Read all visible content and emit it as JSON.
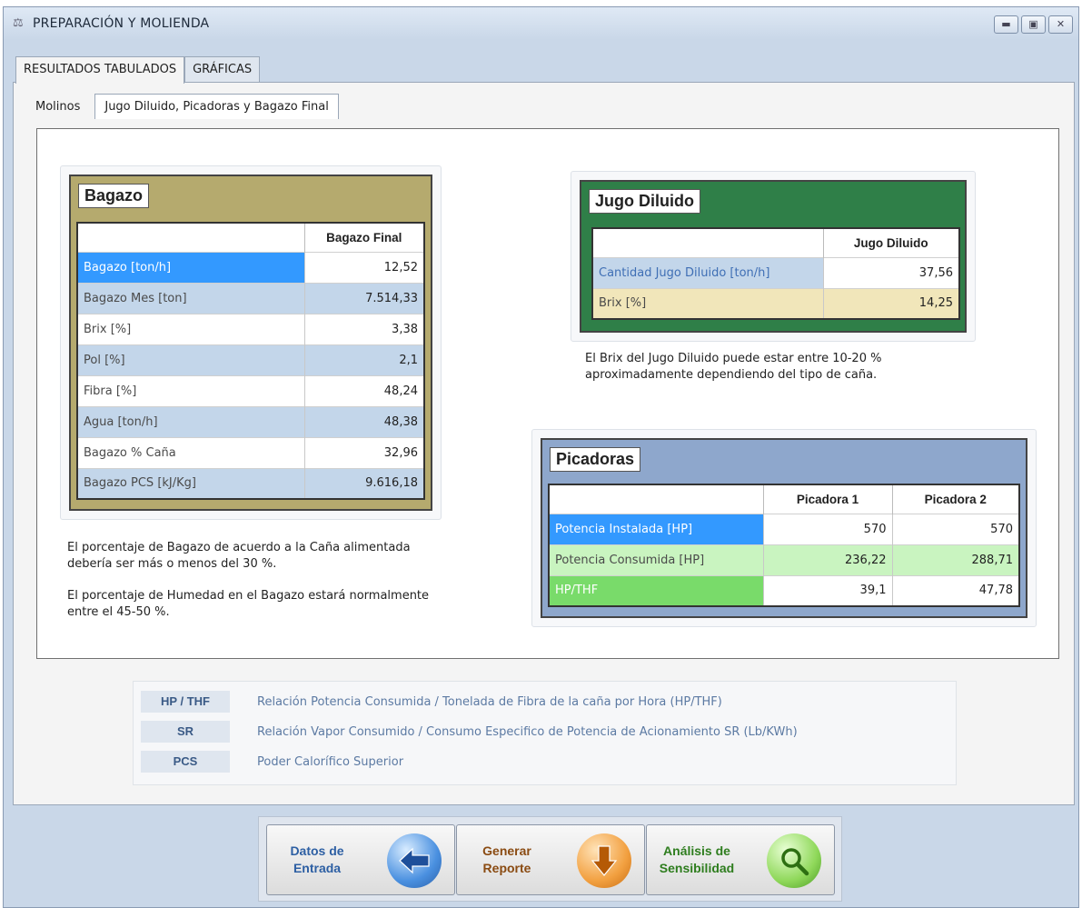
{
  "window": {
    "title": "PREPARACIÓN Y MOLIENDA",
    "controls": [
      "minimize",
      "maximize",
      "close"
    ]
  },
  "tabs": [
    {
      "label": "RESULTADOS TABULADOS",
      "active": true
    },
    {
      "label": "GRÁFICAS",
      "active": false
    }
  ],
  "subtabs": [
    {
      "label": "Molinos",
      "active": false
    },
    {
      "label": "Jugo Diluido, Picadoras y Bagazo Final",
      "active": true
    }
  ],
  "bagazo": {
    "title": "Bagazo",
    "column": "Bagazo Final",
    "rows": [
      {
        "label": "Bagazo [ton/h]",
        "value": "12,52"
      },
      {
        "label": "Bagazo Mes [ton]",
        "value": "7.514,33"
      },
      {
        "label": "Brix [%]",
        "value": "3,38"
      },
      {
        "label": "Pol [%]",
        "value": "2,1"
      },
      {
        "label": "Fibra [%]",
        "value": "48,24"
      },
      {
        "label": "Agua [ton/h]",
        "value": "48,38"
      },
      {
        "label": "Bagazo % Caña",
        "value": "32,96"
      },
      {
        "label": "Bagazo PCS [kJ/Kg]",
        "value": "9.616,18"
      }
    ],
    "note1": "El porcentaje de Bagazo de acuerdo a la Caña alimentada debería ser más o menos del 30 %.",
    "note2": "El porcentaje de Humedad en el Bagazo estará normalmente entre el 45-50 %."
  },
  "jugo": {
    "title": "Jugo Diluido",
    "column": "Jugo Diluido",
    "rows": [
      {
        "label": "Cantidad Jugo Diluido [ton/h]",
        "value": "37,56"
      },
      {
        "label": "Brix [%]",
        "value": "14,25"
      }
    ],
    "note": "El Brix del Jugo Diluido puede estar entre 10-20 % aproximadamente dependiendo del tipo de caña."
  },
  "picadoras": {
    "title": "Picadoras",
    "columns": [
      "Picadora 1",
      "Picadora 2"
    ],
    "rows": [
      {
        "label": "Potencia Instalada [HP]",
        "v1": "570",
        "v2": "570"
      },
      {
        "label": "Potencia Consumida [HP]",
        "v1": "236,22",
        "v2": "288,71"
      },
      {
        "label": "HP/THF",
        "v1": "39,1",
        "v2": "47,78"
      }
    ]
  },
  "legend": [
    {
      "abbr": "HP / THF",
      "desc": "Relación Potencia Consumida / Tonelada de Fibra de la caña por Hora (HP/THF)"
    },
    {
      "abbr": "SR",
      "desc": "Relación Vapor Consumido / Consumo Especifico de Potencia de Acionamiento SR (Lb/KWh)"
    },
    {
      "abbr": "PCS",
      "desc": "Poder Calorífico Superior"
    }
  ],
  "buttons": {
    "datos": {
      "line1": "Datos de",
      "line2": "Entrada",
      "color": "#2d5fa3"
    },
    "generar": {
      "line1": "Generar",
      "line2": "Reporte",
      "color": "#8a4b12"
    },
    "analisis": {
      "line1": "Análisis de",
      "line2": "Sensibilidad",
      "color": "#2e7d1e"
    }
  },
  "colors": {
    "bagazo_header": "#b5aa6e",
    "jugo_header": "#2f7f48",
    "picadoras_header": "#8ea7cc",
    "row_highlight": "#3399ff",
    "row_blue": "#c3d6ea",
    "row_yellow": "#f1e6ba",
    "row_green": "#c9f4c0",
    "row_green_strong": "#79db6a"
  }
}
